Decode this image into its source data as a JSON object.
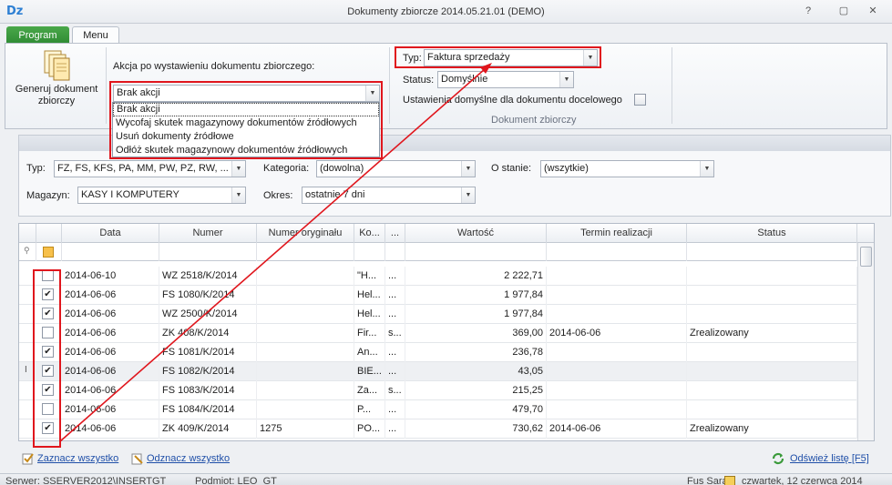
{
  "window": {
    "title": "Dokumenty zbiorcze 2014.05.21.01 (DEMO)",
    "logo_text": "Dz",
    "help": "?",
    "restore": "▢",
    "maximize": "⧉",
    "close": "✕"
  },
  "tabs": {
    "program": "Program",
    "menu": "Menu"
  },
  "ribbon": {
    "generate_label": "Generuj dokument zbiorczy",
    "action_label": "Akcja po wystawieniu dokumentu zbiorczego:",
    "action_value": "Brak akcji",
    "action_options": [
      "Brak akcji",
      "Wycofaj skutek magazynowy dokumentów źródłowych",
      "Usuń dokumenty źródłowe",
      "Odłóż skutek magazynowy dokumentów źródłowych"
    ],
    "typ_label": "Typ:",
    "typ_value": "Faktura sprzedaży",
    "status_label": "Status:",
    "status_value": "Domyślnie",
    "defaults_label": "Ustawienia domyślne dla dokumentu docelowego",
    "group_caption": "Dokument zbiorczy"
  },
  "filters": {
    "typ_label": "Typ:",
    "typ_value": "FZ, FS, KFS, PA, MM, PW, PZ, RW, ...",
    "kategoria_label": "Kategoria:",
    "kategoria_value": "(dowolna)",
    "ostanie_label": "O stanie:",
    "ostanie_value": "(wszytkie)",
    "magazyn_label": "Magazyn:",
    "magazyn_value": "KASY I KOMPUTERY",
    "okres_label": "Okres:",
    "okres_value": "ostatnie 7 dni"
  },
  "grid": {
    "columns": [
      "Data",
      "Numer",
      "Numer oryginału",
      "Ko...",
      "...",
      "Wartość",
      "Termin realizacji",
      "Status"
    ],
    "rows": [
      {
        "checked": false,
        "data": "2014-06-10",
        "numer": "WZ 2518/K/2014",
        "orig": "",
        "ko": "\"H...",
        "x": "...",
        "wartosc": "2 222,71",
        "termin": "",
        "status": ""
      },
      {
        "checked": true,
        "data": "2014-06-06",
        "numer": "FS 1080/K/2014",
        "orig": "",
        "ko": "Hel...",
        "x": "...",
        "wartosc": "1 977,84",
        "termin": "",
        "status": ""
      },
      {
        "checked": true,
        "data": "2014-06-06",
        "numer": "WZ 2500/K/2014",
        "orig": "",
        "ko": "Hel...",
        "x": "...",
        "wartosc": "1 977,84",
        "termin": "",
        "status": ""
      },
      {
        "checked": false,
        "data": "2014-06-06",
        "numer": "ZK 408/K/2014",
        "orig": "",
        "ko": "Fir...",
        "x": "s...",
        "wartosc": "369,00",
        "termin": "2014-06-06",
        "status": "Zrealizowany"
      },
      {
        "checked": true,
        "data": "2014-06-06",
        "numer": "FS 1081/K/2014",
        "orig": "",
        "ko": "An...",
        "x": "...",
        "wartosc": "236,78",
        "termin": "",
        "status": ""
      },
      {
        "checked": true,
        "data": "2014-06-06",
        "numer": "FS 1082/K/2014",
        "orig": "",
        "ko": "BIE...",
        "x": "...",
        "wartosc": "43,05",
        "termin": "",
        "status": ""
      },
      {
        "checked": true,
        "data": "2014-06-06",
        "numer": "FS 1083/K/2014",
        "orig": "",
        "ko": "Za...",
        "x": "s...",
        "wartosc": "215,25",
        "termin": "",
        "status": ""
      },
      {
        "checked": false,
        "data": "2014-06-06",
        "numer": "FS 1084/K/2014",
        "orig": "",
        "ko": "P...",
        "x": "...",
        "wartosc": "479,70",
        "termin": "",
        "status": ""
      },
      {
        "checked": true,
        "data": "2014-06-06",
        "numer": "ZK 409/K/2014",
        "orig": "1275",
        "ko": "PO...",
        "x": "...",
        "wartosc": "730,62",
        "termin": "2014-06-06",
        "status": "Zrealizowany"
      }
    ]
  },
  "footer": {
    "select_all": "Zaznacz wszystko",
    "deselect_all": "Odznacz wszystko",
    "refresh": "Odśwież listę [F5]"
  },
  "statusbar": {
    "server": "Serwer: SSERVER2012\\INSERTGT",
    "entity": "Podmiot: LEO_GT",
    "user": "Fus Sara",
    "date": "czwartek, 12 czerwca 2014"
  },
  "colors": {
    "accent_green": "#2e8a33",
    "annotation_red": "#e0161d",
    "link_blue": "#1f4fa8"
  }
}
